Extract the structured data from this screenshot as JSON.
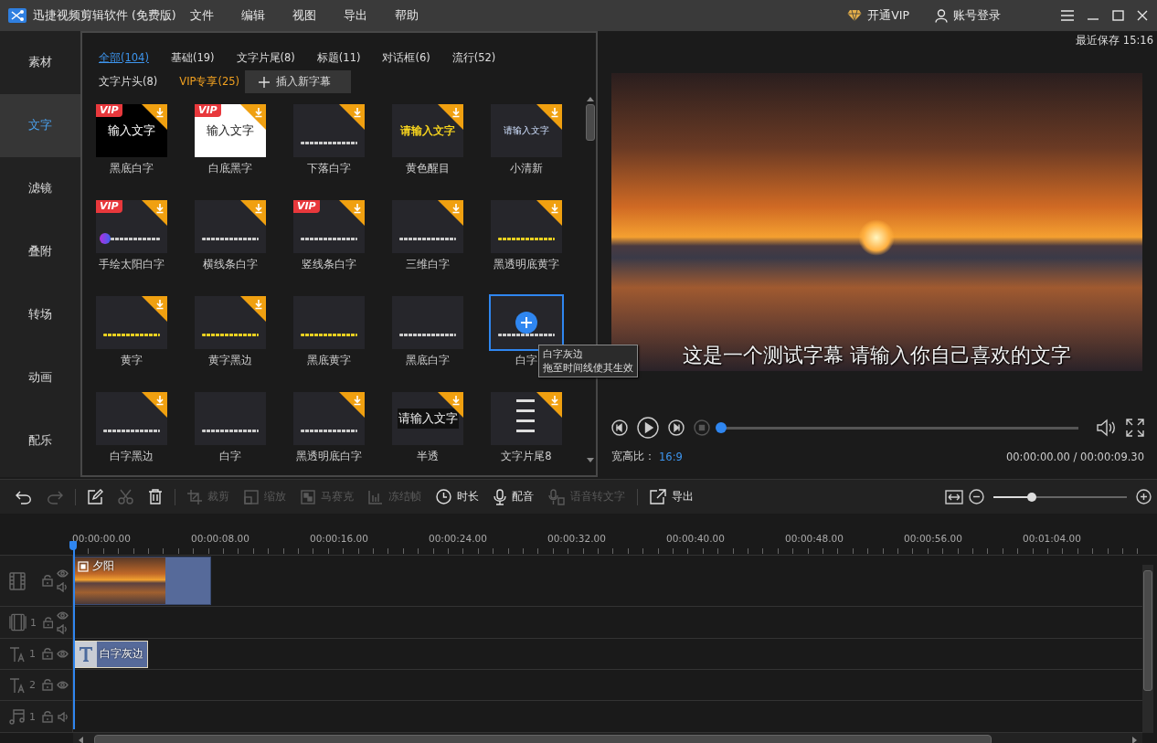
{
  "app": {
    "title": "迅捷视频剪辑软件 (免费版)",
    "menus": [
      "文件",
      "编辑",
      "视图",
      "导出",
      "帮助"
    ],
    "vip": "开通VIP",
    "login": "账号登录"
  },
  "sidebar": {
    "items": [
      {
        "label": "素材",
        "selected": false
      },
      {
        "label": "文字",
        "selected": true
      },
      {
        "label": "滤镜",
        "selected": false
      },
      {
        "label": "叠附",
        "selected": false
      },
      {
        "label": "转场",
        "selected": false
      },
      {
        "label": "动画",
        "selected": false
      },
      {
        "label": "配乐",
        "selected": false
      }
    ]
  },
  "caption_panel": {
    "categories": [
      {
        "label": "全部(104)",
        "selected": true,
        "kind": "normal"
      },
      {
        "label": "基础(19)",
        "selected": false,
        "kind": "normal"
      },
      {
        "label": "文字片尾(8)",
        "selected": false,
        "kind": "normal"
      },
      {
        "label": "标题(11)",
        "selected": false,
        "kind": "normal"
      },
      {
        "label": "对话框(6)",
        "selected": false,
        "kind": "normal"
      },
      {
        "label": "流行(52)",
        "selected": false,
        "kind": "normal"
      },
      {
        "label": "文字片头(8)",
        "selected": false,
        "kind": "normal"
      },
      {
        "label": "VIP专享(25)",
        "selected": false,
        "kind": "vip"
      }
    ],
    "insert_button": "插入新字幕",
    "templates": [
      {
        "label": "黑底白字",
        "badge": "VIP",
        "download": true,
        "selected": false,
        "preview": {
          "kind": "black",
          "text": "输入文字"
        }
      },
      {
        "label": "白底黑字",
        "badge": "VIP",
        "download": true,
        "selected": false,
        "preview": {
          "kind": "white",
          "text": "输入文字"
        }
      },
      {
        "label": "下落白字",
        "download": true,
        "selected": false,
        "preview": {
          "kind": "line-white"
        }
      },
      {
        "label": "黄色醒目",
        "download": true,
        "selected": false,
        "preview": {
          "kind": "yellow",
          "text": "请输入文字"
        }
      },
      {
        "label": "小清新",
        "download": true,
        "selected": false,
        "preview": {
          "kind": "light",
          "text": "请输入文字"
        }
      },
      {
        "label": "手绘太阳白字",
        "badge": "VIP",
        "download": true,
        "selected": false,
        "preview": {
          "kind": "sun"
        }
      },
      {
        "label": "横线条白字",
        "download": true,
        "selected": false,
        "preview": {
          "kind": "line-white"
        }
      },
      {
        "label": "竖线条白字",
        "badge": "VIP",
        "download": true,
        "selected": false,
        "preview": {
          "kind": "line-white"
        }
      },
      {
        "label": "三维白字",
        "download": true,
        "selected": false,
        "preview": {
          "kind": "line-white"
        }
      },
      {
        "label": "黑透明底黄字",
        "download": true,
        "selected": false,
        "preview": {
          "kind": "line-yellow"
        }
      },
      {
        "label": "黄字",
        "download": true,
        "selected": false,
        "preview": {
          "kind": "line-yellow"
        }
      },
      {
        "label": "黄字黑边",
        "download": true,
        "selected": false,
        "preview": {
          "kind": "line-yellow"
        }
      },
      {
        "label": "黑底黄字",
        "download": false,
        "selected": false,
        "preview": {
          "kind": "line-yellow"
        }
      },
      {
        "label": "黑底白字",
        "download": false,
        "selected": false,
        "preview": {
          "kind": "line-white"
        }
      },
      {
        "label": "白字",
        "download": false,
        "selected": true,
        "preview": {
          "kind": "line-white"
        }
      },
      {
        "label": "白字黑边",
        "download": true,
        "selected": false,
        "preview": {
          "kind": "line-white"
        }
      },
      {
        "label": "白字",
        "download": false,
        "selected": false,
        "preview": {
          "kind": "line-white"
        }
      },
      {
        "label": "黑透明底白字",
        "download": true,
        "selected": false,
        "preview": {
          "kind": "line-white"
        }
      },
      {
        "label": "半透",
        "download": true,
        "selected": false,
        "preview": {
          "kind": "banner",
          "text": "请输入文字"
        }
      },
      {
        "label": "文字片尾8",
        "download": true,
        "selected": false,
        "preview": {
          "kind": "list"
        }
      }
    ],
    "tooltip": {
      "title": "白字灰边",
      "hint": "拖至时间线使其生效"
    }
  },
  "preview": {
    "last_saved": "最近保存 15:16",
    "subtitle": "这是一个测试字幕 请输入你自己喜欢的文字",
    "progress": {
      "level": 0
    },
    "aspect_label": "宽高比：",
    "aspect": "16:9",
    "time": "00:00:00.00 / 00:00:09.30"
  },
  "toolbar": {
    "groups": [
      [
        {
          "kind": "undo",
          "disabled": false
        },
        {
          "kind": "redo",
          "disabled": true
        }
      ],
      [
        {
          "kind": "edit",
          "disabled": false
        },
        {
          "kind": "cut",
          "disabled": true
        },
        {
          "kind": "delete",
          "disabled": false
        }
      ],
      [
        {
          "kind": "crop",
          "label": "裁剪",
          "disabled": true
        },
        {
          "kind": "zoom",
          "label": "缩放",
          "disabled": true
        },
        {
          "kind": "mosaic",
          "label": "马赛克",
          "disabled": true
        },
        {
          "kind": "freeze",
          "label": "冻结帧",
          "disabled": true
        },
        {
          "kind": "duration",
          "label": "时长",
          "disabled": false
        },
        {
          "kind": "voice",
          "label": "配音",
          "disabled": false
        },
        {
          "kind": "speech",
          "label": "语音转文字",
          "disabled": true
        }
      ],
      [
        {
          "kind": "export",
          "label": "导出",
          "disabled": false
        }
      ]
    ],
    "zoom": {
      "level": 0.29
    }
  },
  "timeline": {
    "ruler": [
      "00:00:00.00",
      "00:00:08.00",
      "00:00:16.00",
      "00:00:24.00",
      "00:00:32.00",
      "00:00:40.00",
      "00:00:48.00",
      "00:00:56.00",
      "00:01:04.00"
    ],
    "tracks": [
      {
        "kind": "video",
        "lock": true,
        "eye": true,
        "sound": true,
        "clips": [
          {
            "kind": "video",
            "label": "夕阳"
          }
        ]
      },
      {
        "kind": "overlay",
        "number": "1",
        "lock": true,
        "eye": true,
        "sound": true
      },
      {
        "kind": "text",
        "number": "1",
        "lock": true,
        "eye": true,
        "sound": false,
        "clips": [
          {
            "kind": "text",
            "label": "白字灰边"
          }
        ]
      },
      {
        "kind": "text",
        "number": "2",
        "lock": true,
        "eye": true,
        "sound": false
      },
      {
        "kind": "music",
        "number": "1",
        "lock": true,
        "eye": false,
        "sound": true
      }
    ]
  }
}
